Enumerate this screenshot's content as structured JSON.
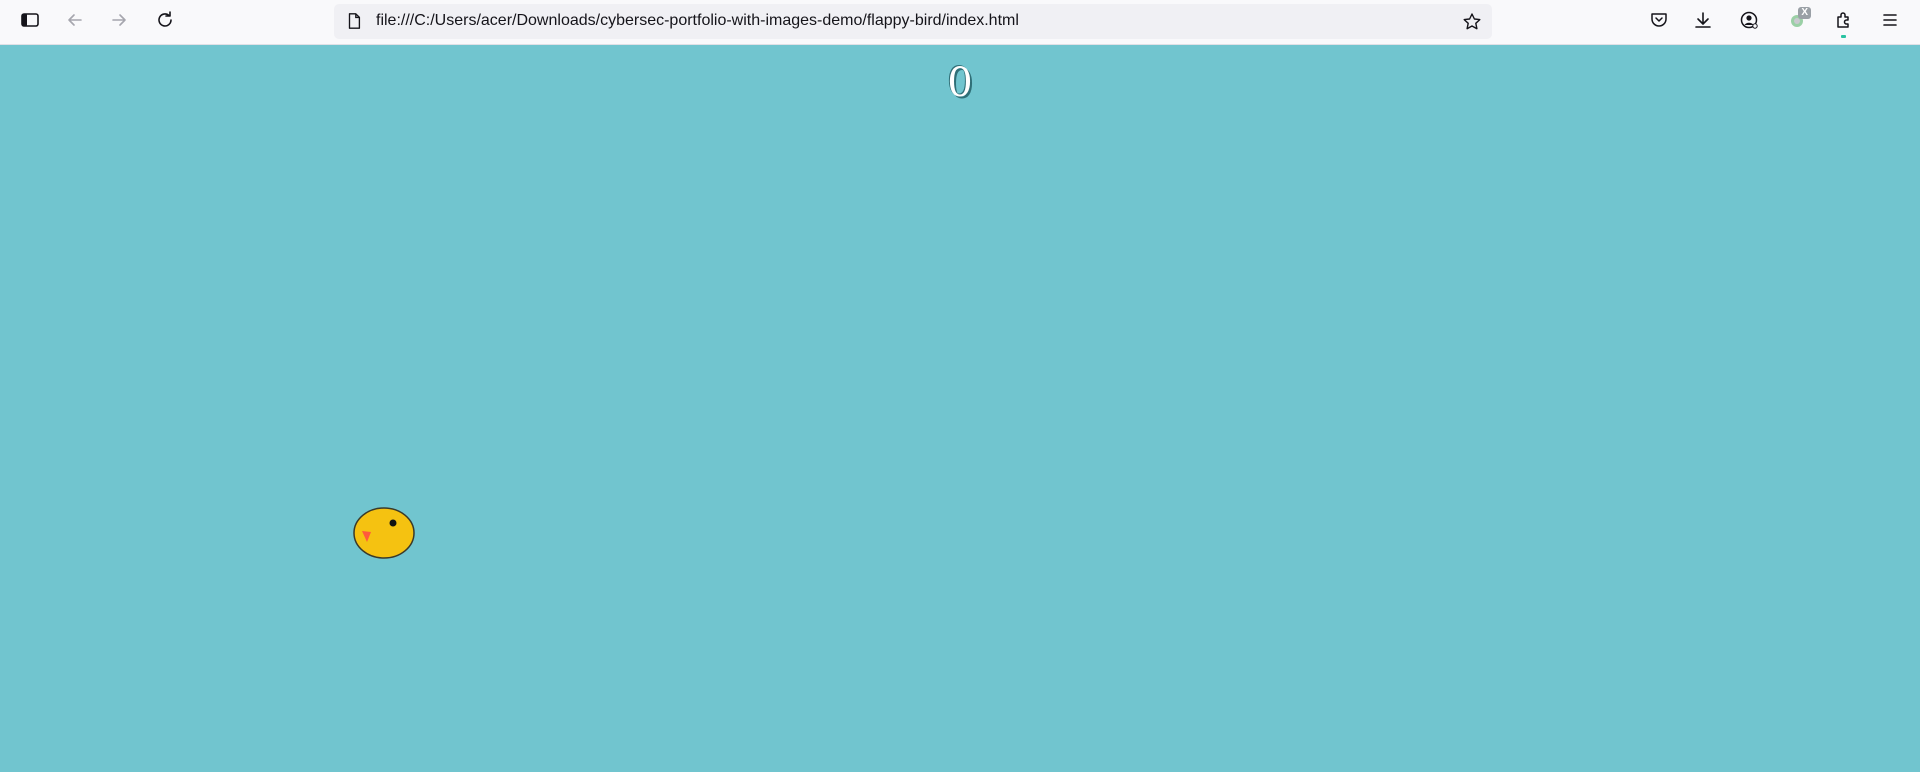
{
  "browser": {
    "url": "file:///C:/Users/acer/Downloads/cybersec-portfolio-with-images-demo/flappy-bird/index.html",
    "extension_badge": "X",
    "icons": [
      "sidebar-icon",
      "back-icon",
      "forward-icon",
      "reload-icon",
      "file-icon",
      "bookmark-star-icon",
      "pocket-icon",
      "downloads-icon",
      "account-icon",
      "extension-icon",
      "extensions-puzzle-icon",
      "menu-icon"
    ]
  },
  "game": {
    "score": "0",
    "colors": {
      "sky": "#71c5cf",
      "bird_body": "#f5c211",
      "bird_beak": "#ff5a3c",
      "bird_outline": "#3a3a2a"
    }
  }
}
